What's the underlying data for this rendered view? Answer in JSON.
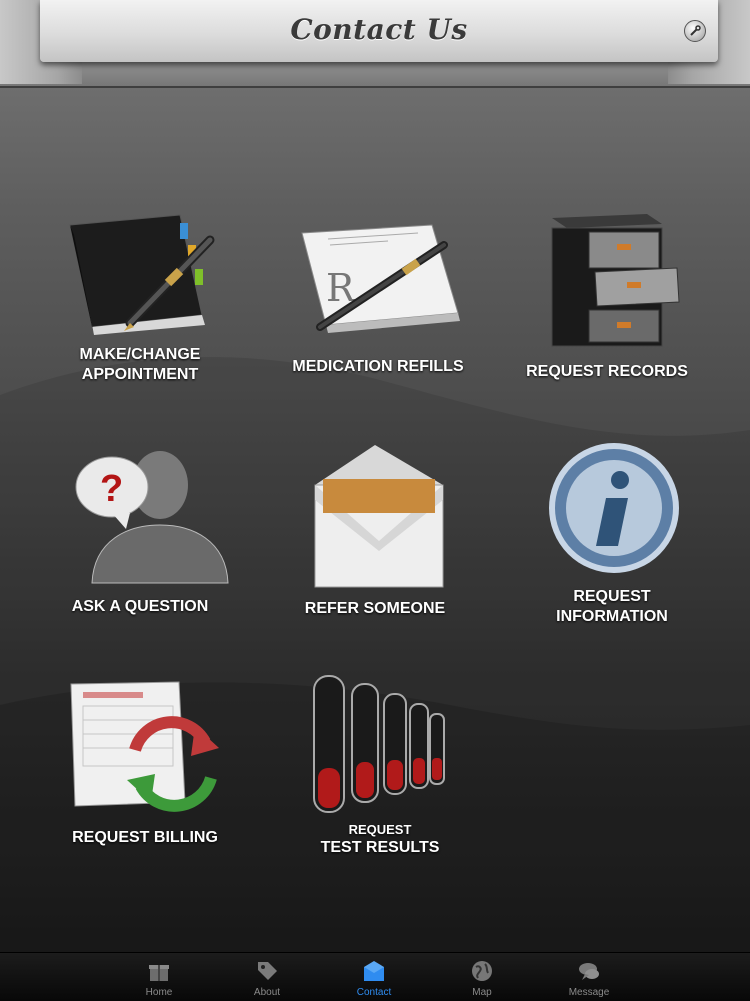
{
  "header": {
    "title": "Contact Us"
  },
  "tiles": [
    {
      "id": "make-change-appointment",
      "line1": "MAKE/CHANGE",
      "line2": "APPOINTMENT"
    },
    {
      "id": "medication-refills",
      "line1": "MEDICATION REFILLS"
    },
    {
      "id": "request-records",
      "line1": "REQUEST RECORDS"
    },
    {
      "id": "ask-a-question",
      "line1": "ASK A QUESTION"
    },
    {
      "id": "refer-someone",
      "line1": "REFER SOMEONE"
    },
    {
      "id": "request-information",
      "line1": "REQUEST",
      "line2": "INFORMATION"
    },
    {
      "id": "request-billing",
      "line1": "REQUEST BILLING"
    },
    {
      "id": "request-test-results",
      "line1": "REQUEST",
      "line2": "TEST RESULTS"
    }
  ],
  "tabbar": {
    "tabs": [
      {
        "label": "Home",
        "icon": "gift-icon"
      },
      {
        "label": "About",
        "icon": "tag-icon"
      },
      {
        "label": "Contact",
        "icon": "envelope-icon",
        "active": true
      },
      {
        "label": "Map",
        "icon": "globe-icon"
      },
      {
        "label": "Message",
        "icon": "chat-bubble-icon"
      }
    ]
  },
  "colors": {
    "active_tab": "#2f8cf0",
    "inactive_tab": "#8a8a8a",
    "label": "#ffffff"
  }
}
